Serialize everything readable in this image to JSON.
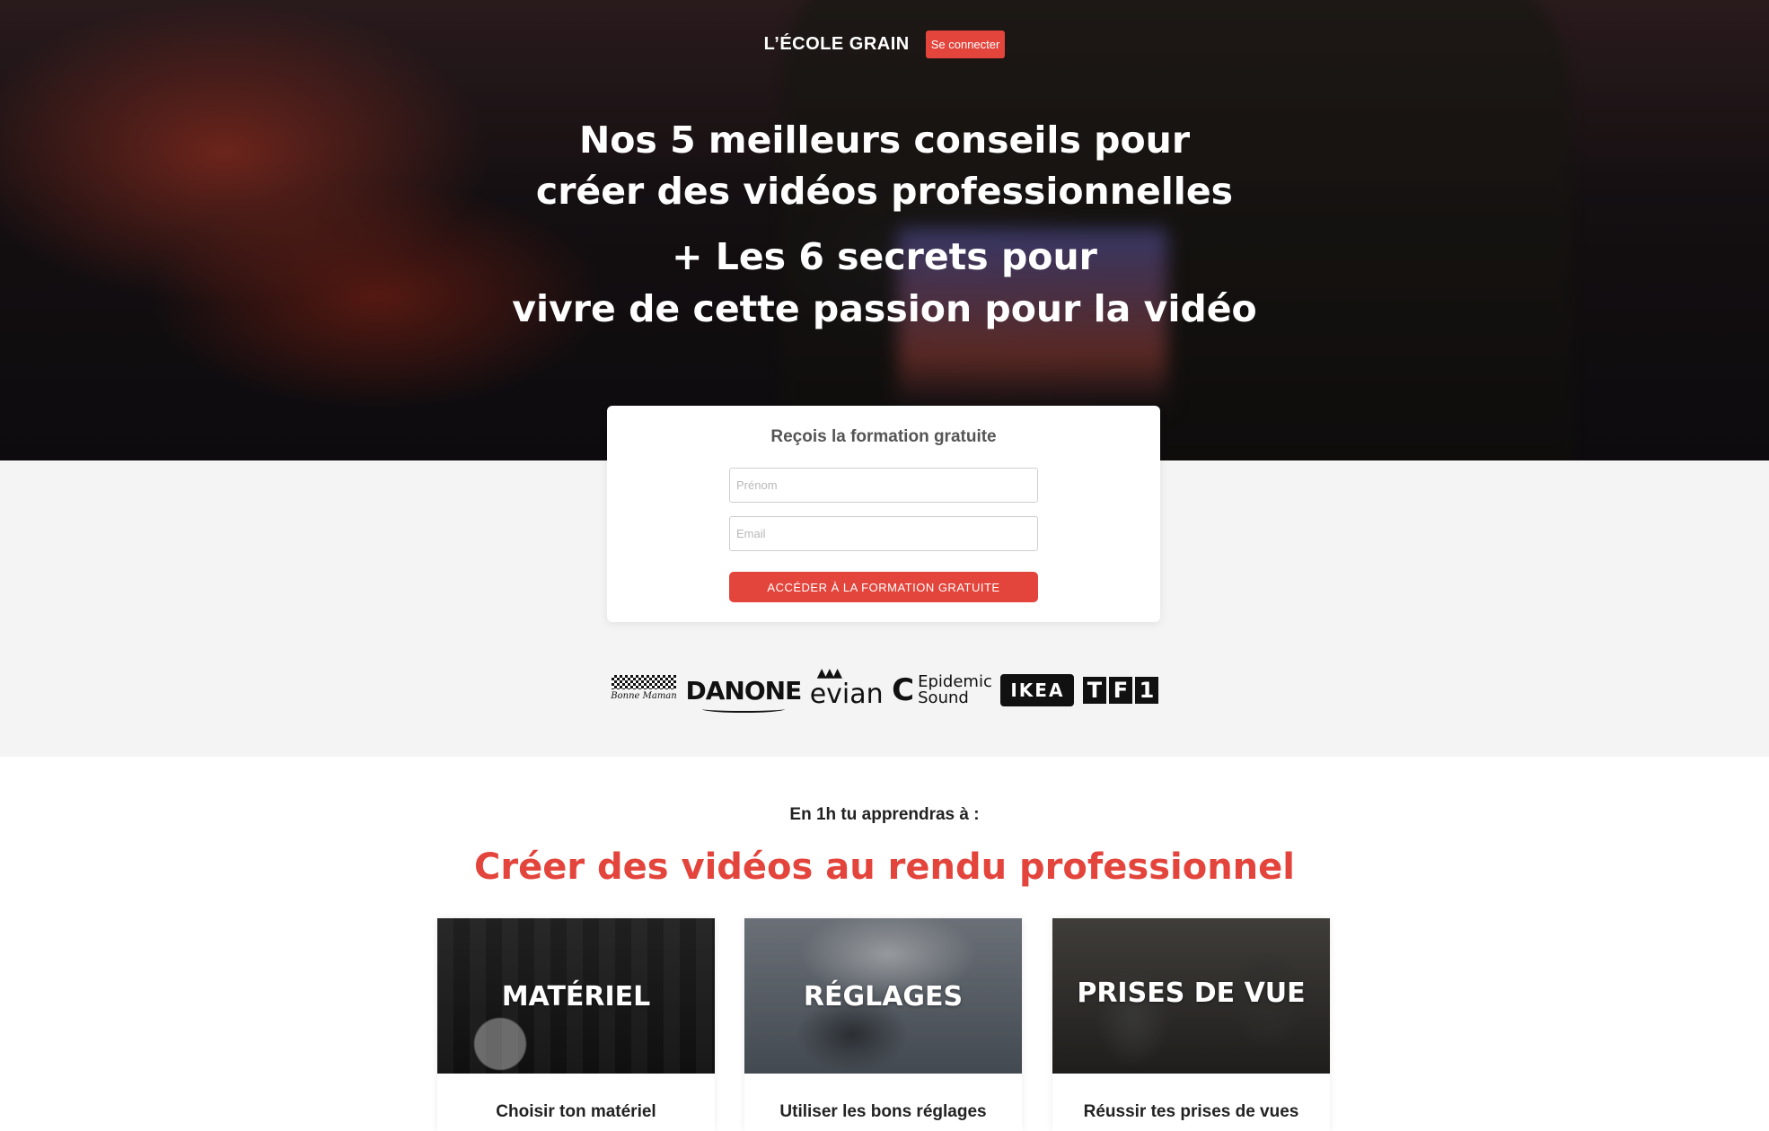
{
  "header": {
    "brand": "L’ÉCOLE GRAIN",
    "login_label": "Se connecter"
  },
  "hero": {
    "line1": "Nos 5 meilleurs conseils pour",
    "line2": "créer des vidéos professionnelles",
    "line3": "+ Les 6 secrets pour",
    "line4": "vivre de cette passion pour la vidéo"
  },
  "form": {
    "title": "Reçois la formation gratuite",
    "first_name_placeholder": "Prénom",
    "email_placeholder": "Email",
    "submit_label": "ACCÉDER À LA FORMATION GRATUITE"
  },
  "logos": {
    "bonne_maman": "Bonne Maman",
    "danone": "DANONE",
    "evian": "evian",
    "epidemic_line1": "Epidemic",
    "epidemic_line2": "Sound",
    "ikea": "IKEA",
    "tf1": [
      "T",
      "F",
      "1"
    ]
  },
  "learn": {
    "kicker": "En 1h tu apprendras à :",
    "title": "Créer des vidéos au rendu professionnel",
    "features": [
      {
        "image_label": "MATÉRIEL",
        "caption": "Choisir ton matériel"
      },
      {
        "image_label": "RÉGLAGES",
        "caption": "Utiliser les bons réglages"
      },
      {
        "image_label": "PRISES DE VUE",
        "caption": "Réussir tes prises de vues"
      }
    ]
  },
  "colors": {
    "accent": "#e3443b",
    "band_bg": "#f4f4f4"
  }
}
